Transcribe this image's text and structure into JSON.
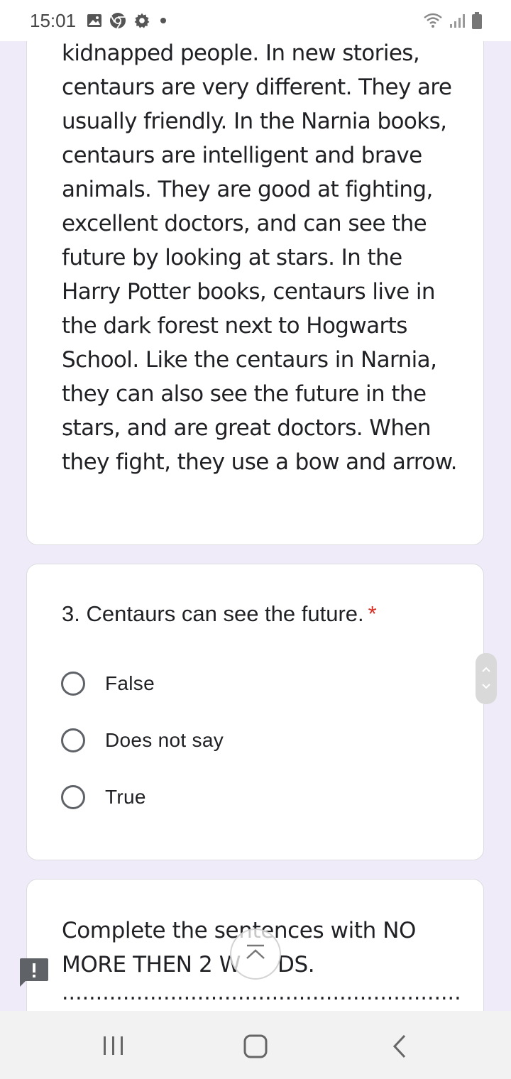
{
  "status_bar": {
    "time": "15:01",
    "left_icons": [
      "gallery-icon",
      "chrome-icon",
      "settings-icon",
      "dot-icon"
    ],
    "right_icons": [
      "wifi-icon",
      "signal-icon",
      "battery-icon"
    ]
  },
  "passage": {
    "text": "kidnapped people. In new stories, centaurs are very different. They are usually friendly. In the Narnia books, centaurs are intelligent and brave animals. They are good at fighting, excellent doctors, and can see the future by looking at stars. In the Harry Potter books, centaurs live in the dark forest next to Hogwarts School. Like the centaurs in Narnia, they can also see the future in the stars, and are great doctors. When they fight, they use a bow and arrow."
  },
  "question": {
    "title": "3. Centaurs can see the future.",
    "required_mark": "*",
    "options": [
      "False",
      "Does not say",
      "True"
    ]
  },
  "section": {
    "title": "Complete the sentences with NO MORE THEN 2 W",
    "title_end": "DS.",
    "blank_line": "..........................................................................C"
  },
  "colors": {
    "background": "#f0ebf8",
    "required": "#d93025"
  }
}
